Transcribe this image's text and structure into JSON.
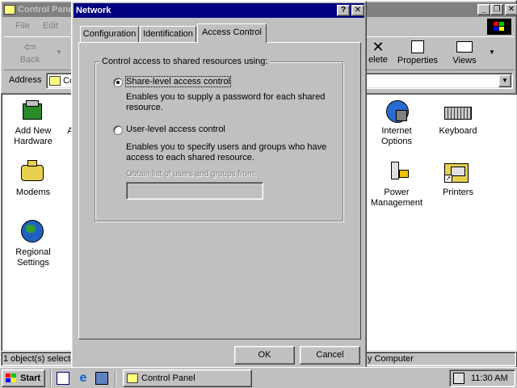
{
  "control_panel": {
    "title": "Control Panel",
    "menu": [
      "File",
      "Edit"
    ],
    "toolbar": {
      "back": "Back",
      "delete": "elete",
      "properties": "Properties",
      "views": "Views"
    },
    "address_label": "Address",
    "address_value": "Co",
    "icons": {
      "add_new_hardware": "Add New\nHardware",
      "partial_a": "A",
      "modems": "Modems",
      "regional_settings": "Regional\nSettings",
      "internet_options": "Internet\nOptions",
      "keyboard": "Keyboard",
      "power_management": "Power\nManagement",
      "printers": "Printers"
    },
    "status_left": "1 object(s) selecte",
    "status_right": "y Computer"
  },
  "dialog": {
    "title": "Network",
    "tabs": [
      "Configuration",
      "Identification",
      "Access Control"
    ],
    "active_tab": "Access Control",
    "group_label": "Control access to shared resources using:",
    "option_share": "Share-level access control",
    "option_share_desc": "Enables you to supply a password for each shared resource.",
    "option_user": "User-level access control",
    "option_user_desc": "Enables you to specify users and groups who have access to each shared resource.",
    "obtain_label": "Obtain list of users and groups from:",
    "obtain_value": "",
    "ok": "OK",
    "cancel": "Cancel"
  },
  "taskbar": {
    "start": "Start",
    "task_control_panel": "Control Panel",
    "clock": "11:30 AM"
  },
  "colors": {
    "desktop": "#c0c0c0",
    "title_active": "#000080",
    "title_inactive": "#808080",
    "window_white": "#ffffff"
  }
}
